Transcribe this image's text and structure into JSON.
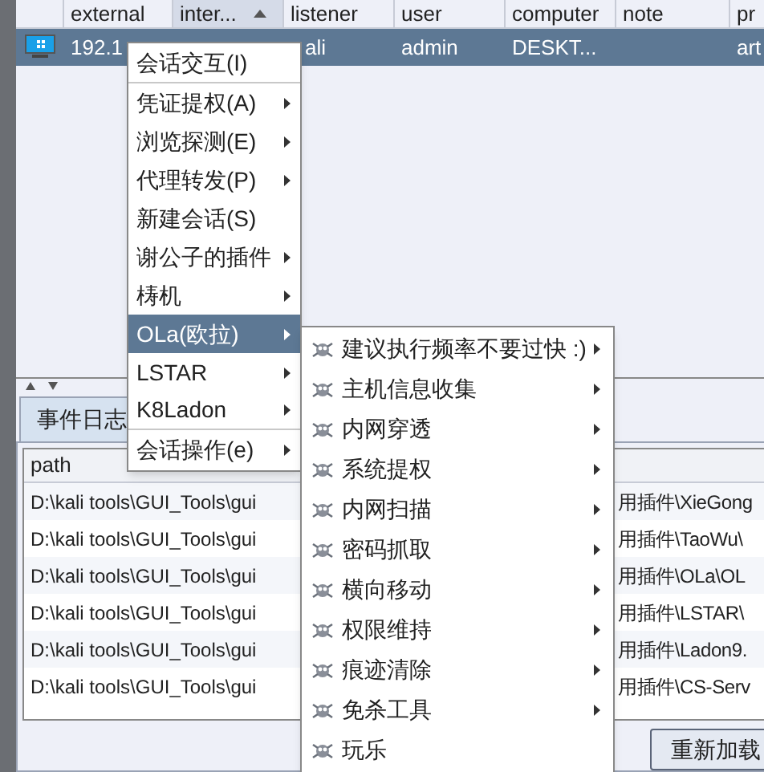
{
  "sessions_table": {
    "columns": [
      {
        "label": "external",
        "sorted": false
      },
      {
        "label": "inter...",
        "sorted": true
      },
      {
        "label": "listener",
        "sorted": false
      },
      {
        "label": "user",
        "sorted": false
      },
      {
        "label": "computer",
        "sorted": false
      },
      {
        "label": "note",
        "sorted": false
      },
      {
        "label": "pr",
        "sorted": false
      }
    ],
    "rows": [
      {
        "selected": true,
        "cells": [
          "192.1",
          "",
          "ali",
          "admin",
          "DESKT...",
          "",
          "art"
        ]
      }
    ]
  },
  "context_menu": {
    "items": [
      {
        "label": "会话交互(I)",
        "submenu": false,
        "selected": false,
        "separator_after": true
      },
      {
        "label": "凭证提权(A)",
        "submenu": true,
        "selected": false,
        "separator_after": false
      },
      {
        "label": "浏览探测(E)",
        "submenu": true,
        "selected": false,
        "separator_after": false
      },
      {
        "label": "代理转发(P)",
        "submenu": true,
        "selected": false,
        "separator_after": false
      },
      {
        "label": "新建会话(S)",
        "submenu": false,
        "selected": false,
        "separator_after": false
      },
      {
        "label": "谢公子的插件",
        "submenu": true,
        "selected": false,
        "separator_after": false
      },
      {
        "label": "梼机",
        "submenu": true,
        "selected": false,
        "separator_after": false
      },
      {
        "label": "OLa(欧拉)",
        "submenu": true,
        "selected": true,
        "separator_after": false
      },
      {
        "label": "LSTAR",
        "submenu": true,
        "selected": false,
        "separator_after": false
      },
      {
        "label": "K8Ladon",
        "submenu": true,
        "selected": false,
        "separator_after": true
      },
      {
        "label": "会话操作(e)",
        "submenu": true,
        "selected": false,
        "separator_after": false
      }
    ]
  },
  "submenu": {
    "items": [
      {
        "label": "建议执行频率不要过快 :)",
        "submenu": true
      },
      {
        "label": "主机信息收集",
        "submenu": true
      },
      {
        "label": "内网穿透",
        "submenu": true
      },
      {
        "label": "系统提权",
        "submenu": true
      },
      {
        "label": "内网扫描",
        "submenu": true
      },
      {
        "label": "密码抓取",
        "submenu": true
      },
      {
        "label": "横向移动",
        "submenu": true
      },
      {
        "label": "权限维持",
        "submenu": true
      },
      {
        "label": "痕迹清除",
        "submenu": true
      },
      {
        "label": "免杀工具",
        "submenu": true
      },
      {
        "label": "玩乐",
        "submenu": false
      }
    ]
  },
  "bottom_tabs": [
    {
      "label": "事件日志",
      "selected": true
    }
  ],
  "scripts_table": {
    "columns": [
      "path"
    ],
    "rows": [
      [
        "D:\\kali tools\\GUI_Tools\\gui",
        "用插件\\XieGong"
      ],
      [
        "D:\\kali tools\\GUI_Tools\\gui",
        "用插件\\TaoWu\\"
      ],
      [
        "D:\\kali tools\\GUI_Tools\\gui",
        "用插件\\OLa\\OL"
      ],
      [
        "D:\\kali tools\\GUI_Tools\\gui",
        "用插件\\LSTAR\\"
      ],
      [
        "D:\\kali tools\\GUI_Tools\\gui",
        "用插件\\Ladon9."
      ],
      [
        "D:\\kali tools\\GUI_Tools\\gui",
        "用插件\\CS-Serv"
      ]
    ]
  },
  "buttons": [
    "重新加载"
  ]
}
